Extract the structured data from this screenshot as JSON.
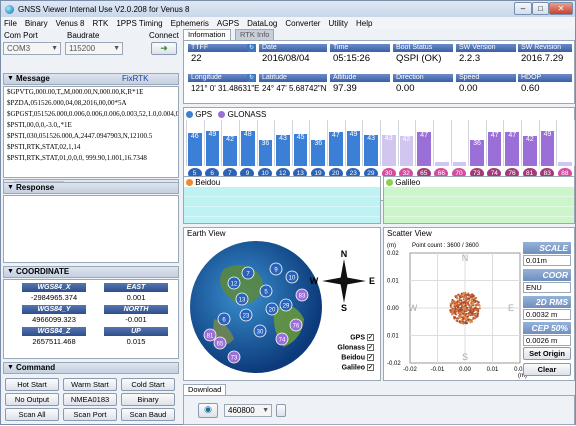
{
  "window": {
    "title": "GNSS Viewer Internal Use V2.0.208 for Venus 8"
  },
  "menu": [
    "File",
    "Binary",
    "Venus 8",
    "RTK",
    "1PPS Timing",
    "Ephemeris",
    "AGPS",
    "DataLog",
    "Converter",
    "Utility",
    "Help"
  ],
  "connection": {
    "com_port_label": "Com Port",
    "baudrate_label": "Baudrate",
    "connect_label": "Connect",
    "com_port": "COM3",
    "baudrate": "115200"
  },
  "message": {
    "title": "Message",
    "fix": "FixRTK",
    "lines": [
      "$GPVTG,000.00,T,,M,000.00,N,000.00,K,R*1E",
      "$PZDA,051526.000,04,08,2016,00,00*5A",
      "$GPGST,051526.000,0.006,0.006,0.006,0.003,52,1.0,0.004,0",
      "$PSTI,00,0,0,-3.0,,*1E",
      "$PSTI,030,051526.000,A,2447.0947903,N,12100.5",
      "$PSTI,RTK,STAT,02,1,14",
      "$PSTI,RTK,STAT,01,0,0,0, 999.90,1.001,16.7348"
    ]
  },
  "response": {
    "title": "Response"
  },
  "coordinate": {
    "title": "COORDINATE",
    "headers": [
      "WGS84_X",
      "EAST",
      "WGS84_Y",
      "NORTH",
      "WGS84_Z",
      "UP"
    ],
    "values": [
      "-2984965.374",
      "0.001",
      "4966099.323",
      "-0.001",
      "2657511.468",
      "0.015"
    ]
  },
  "command": {
    "title": "Command",
    "buttons": [
      "Hot Start",
      "Warm Start",
      "Cold Start",
      "No Output",
      "NMEA0183",
      "Binary",
      "Scan All",
      "Scan Port",
      "Scan Baud"
    ]
  },
  "tabs": [
    "Information",
    "RTK Info"
  ],
  "info": {
    "ttff": {
      "label": "TTFF",
      "value": "22"
    },
    "date": {
      "label": "Date",
      "value": "2016/08/04"
    },
    "time": {
      "label": "Time",
      "value": "05:15:26"
    },
    "boot": {
      "label": "Boot Status",
      "value": "QSPI (OK)"
    },
    "swver": {
      "label": "SW Version",
      "value": "2.2.3"
    },
    "swrev": {
      "label": "SW Revision",
      "value": "2016.7.29"
    },
    "lon": {
      "label": "Longitude",
      "value": "121° 0' 31.48631\"E"
    },
    "lat": {
      "label": "Latitude",
      "value": "24° 47' 5.68742\"N"
    },
    "alt": {
      "label": "Altitude",
      "value": "97.39"
    },
    "dir": {
      "label": "Direction",
      "value": "0.00"
    },
    "speed": {
      "label": "Speed",
      "value": "0.00"
    },
    "hdop": {
      "label": "HDOP",
      "value": "0.60"
    }
  },
  "snr": {
    "legend": [
      "GPS",
      "GLONASS"
    ],
    "bars": [
      {
        "snr": "46",
        "prn": "5",
        "color": "#3c7fd6",
        "level": 0.46
      },
      {
        "snr": "49",
        "prn": "6",
        "color": "#3c7fd6",
        "level": 0.49
      },
      {
        "snr": "42",
        "prn": "7",
        "color": "#3c7fd6",
        "level": 0.42
      },
      {
        "snr": "48",
        "prn": "9",
        "color": "#3c7fd6",
        "level": 0.48
      },
      {
        "snr": "36",
        "prn": "10",
        "color": "#3c7fd6",
        "level": 0.36
      },
      {
        "snr": "43",
        "prn": "12",
        "color": "#3c7fd6",
        "level": 0.43
      },
      {
        "snr": "45",
        "prn": "13",
        "color": "#3c7fd6",
        "level": 0.45
      },
      {
        "snr": "36",
        "prn": "19",
        "color": "#3c7fd6",
        "level": 0.36
      },
      {
        "snr": "47",
        "prn": "20",
        "color": "#3c7fd6",
        "level": 0.47
      },
      {
        "snr": "49",
        "prn": "23",
        "color": "#3c7fd6",
        "level": 0.49
      },
      {
        "snr": "43",
        "prn": "29",
        "color": "#3c7fd6",
        "level": 0.43
      },
      {
        "snr": "43",
        "prn": "30",
        "color": "#d0c6f0",
        "level": 0.43
      },
      {
        "snr": "42",
        "prn": "32",
        "color": "#d0c6f0",
        "level": 0.42
      },
      {
        "snr": "47",
        "prn": "65",
        "color": "#9b6fd8",
        "level": 0.47
      },
      {
        "snr": "",
        "prn": "66",
        "color": "#d0c6f0",
        "level": 0.0
      },
      {
        "snr": "",
        "prn": "70",
        "color": "#d0c6f0",
        "level": 0.0
      },
      {
        "snr": "36",
        "prn": "73",
        "color": "#9b6fd8",
        "level": 0.36
      },
      {
        "snr": "47",
        "prn": "74",
        "color": "#9b6fd8",
        "level": 0.47
      },
      {
        "snr": "47",
        "prn": "76",
        "color": "#9b6fd8",
        "level": 0.47
      },
      {
        "snr": "42",
        "prn": "81",
        "color": "#9b6fd8",
        "level": 0.42
      },
      {
        "snr": "49",
        "prn": "83",
        "color": "#9b6fd8",
        "level": 0.49
      },
      {
        "snr": "",
        "prn": "88",
        "color": "#d0c6f0",
        "level": 0.0
      }
    ]
  },
  "beidou": {
    "title": "Beidou"
  },
  "galileo": {
    "title": "Galileo"
  },
  "earth": {
    "title": "Earth View",
    "N": "N",
    "E": "E",
    "W": "W",
    "S": "S",
    "sats": [
      "5",
      "6",
      "7",
      "9",
      "10",
      "12",
      "13",
      "20",
      "23",
      "29",
      "30",
      "65",
      "73",
      "74",
      "76",
      "81",
      "83"
    ],
    "checks": [
      {
        "label": "GPS",
        "checked": "✓"
      },
      {
        "label": "Glonass",
        "checked": "✓"
      },
      {
        "label": "Beidou",
        "checked": "✓"
      },
      {
        "label": "Galileo",
        "checked": "✓"
      }
    ]
  },
  "scatter": {
    "title": "Scatter View",
    "unit": "(m)",
    "point_count": "Point count : 3600 / 3600",
    "N": "N",
    "S": "S",
    "W": "W",
    "E": "E",
    "yticks": [
      "0.02",
      "0.01",
      "0.00",
      "0.01",
      "-0.02"
    ],
    "xticks": [
      "-0.02",
      "-0.01",
      "0.00",
      "0.01",
      "0.02"
    ],
    "xunit": "(m)",
    "scale_label": "SCALE",
    "scale_value": "0.01m",
    "coor_label": "COOR",
    "coor_value": "ENU",
    "rms_label": "2D RMS",
    "rms_value": "0.0032 m",
    "cep_label": "CEP 50%",
    "cep_value": "0.0026 m",
    "set_origin": "Set Origin",
    "clear": "Clear"
  },
  "download": {
    "tab": "Download",
    "baud": "460800"
  }
}
